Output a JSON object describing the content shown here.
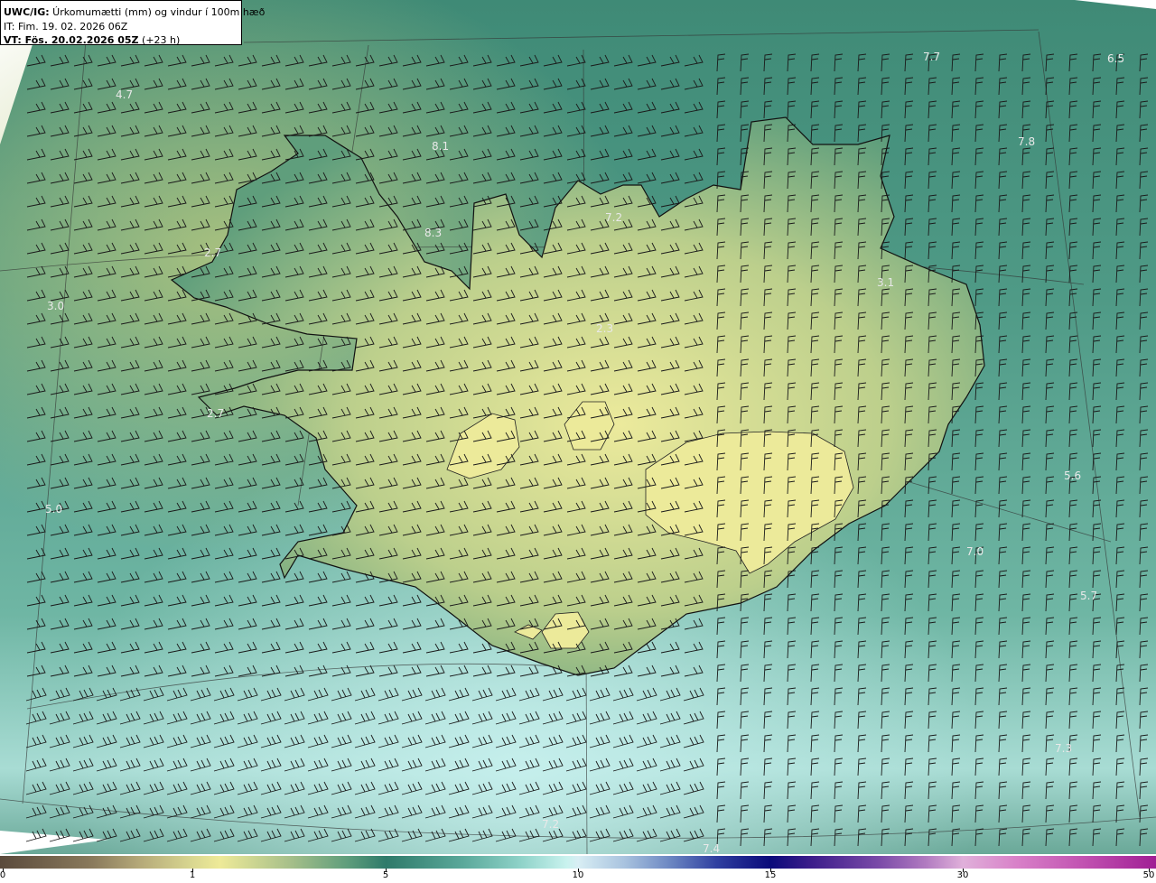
{
  "header": {
    "product_label": "UWC/IG:",
    "product_desc": " Úrkomumætti (mm) og vindur í 100m hæð",
    "init_time": "IT: Fim. 19. 02. 2026 06Z",
    "valid_label": "VT: Fös. 20.02.2026 05Z",
    "valid_offset": " (+23 h)"
  },
  "map_values": [
    "4.7",
    "7.7",
    "6.5",
    "7.8",
    "8.1",
    "8.3",
    "7.2",
    "2.7",
    "3.0",
    "3.1",
    "2.3",
    "2.7",
    "5.0",
    "5.6",
    "7.0",
    "5.7",
    "7.3",
    "7.2",
    "7.4"
  ],
  "colorbar": {
    "ticks": [
      "0",
      "1",
      "5",
      "10",
      "15",
      "30",
      "50"
    ]
  },
  "colors": {
    "land_low": "#e8e89a",
    "land_mid": "#8ab67e",
    "sea": "#4e9684",
    "sea_light": "#bfe8e6",
    "coastline": "#111111"
  }
}
